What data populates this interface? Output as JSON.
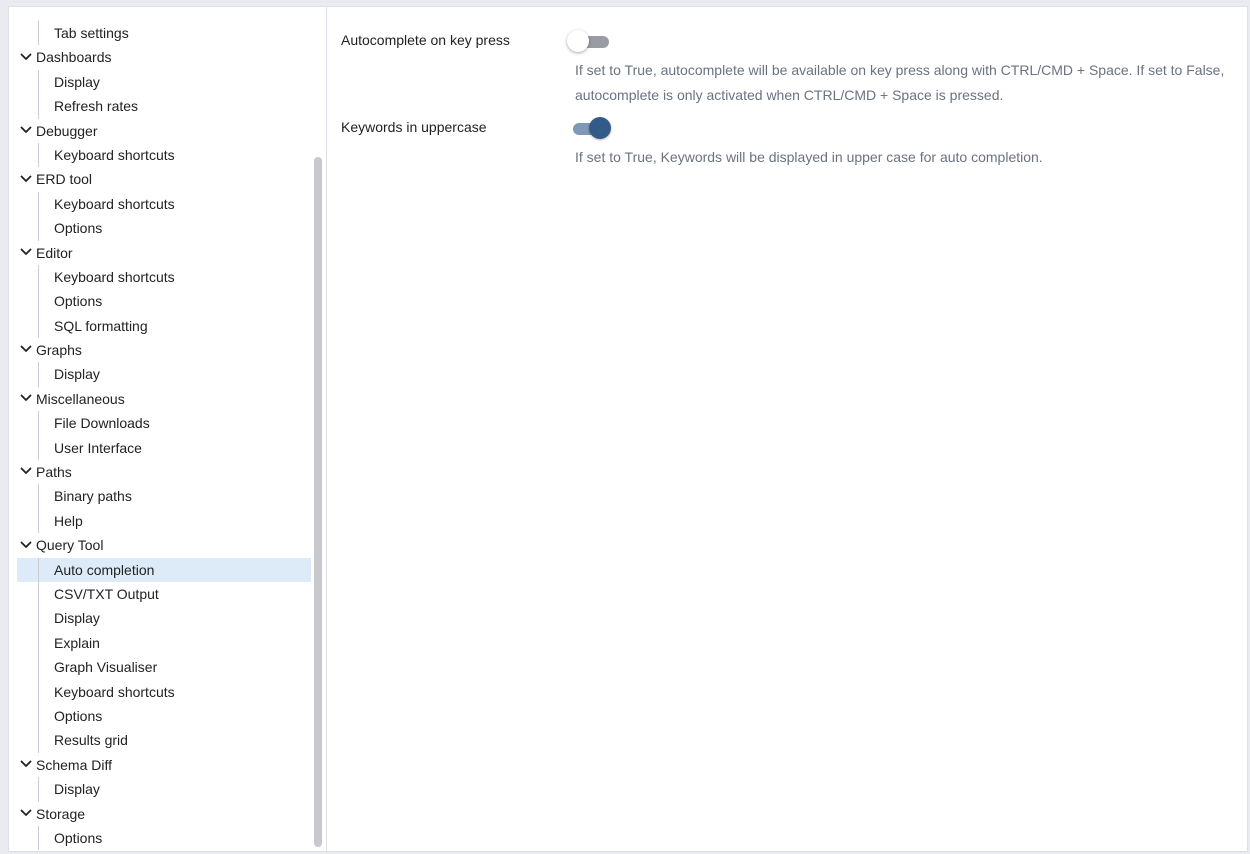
{
  "sidebar": {
    "items": [
      {
        "label": "Tab settings",
        "level": "child"
      },
      {
        "label": "Dashboards",
        "level": "group"
      },
      {
        "label": "Display",
        "level": "child"
      },
      {
        "label": "Refresh rates",
        "level": "child"
      },
      {
        "label": "Debugger",
        "level": "group"
      },
      {
        "label": "Keyboard shortcuts",
        "level": "child"
      },
      {
        "label": "ERD tool",
        "level": "group"
      },
      {
        "label": "Keyboard shortcuts",
        "level": "child"
      },
      {
        "label": "Options",
        "level": "child"
      },
      {
        "label": "Editor",
        "level": "group"
      },
      {
        "label": "Keyboard shortcuts",
        "level": "child"
      },
      {
        "label": "Options",
        "level": "child"
      },
      {
        "label": "SQL formatting",
        "level": "child"
      },
      {
        "label": "Graphs",
        "level": "group"
      },
      {
        "label": "Display",
        "level": "child"
      },
      {
        "label": "Miscellaneous",
        "level": "group"
      },
      {
        "label": "File Downloads",
        "level": "child"
      },
      {
        "label": "User Interface",
        "level": "child"
      },
      {
        "label": "Paths",
        "level": "group"
      },
      {
        "label": "Binary paths",
        "level": "child"
      },
      {
        "label": "Help",
        "level": "child"
      },
      {
        "label": "Query Tool",
        "level": "group"
      },
      {
        "label": "Auto completion",
        "level": "child",
        "selected": true
      },
      {
        "label": "CSV/TXT Output",
        "level": "child"
      },
      {
        "label": "Display",
        "level": "child"
      },
      {
        "label": "Explain",
        "level": "child"
      },
      {
        "label": "Graph Visualiser",
        "level": "child"
      },
      {
        "label": "Keyboard shortcuts",
        "level": "child"
      },
      {
        "label": "Options",
        "level": "child"
      },
      {
        "label": "Results grid",
        "level": "child"
      },
      {
        "label": "Schema Diff",
        "level": "group"
      },
      {
        "label": "Display",
        "level": "child"
      },
      {
        "label": "Storage",
        "level": "group"
      },
      {
        "label": "Options",
        "level": "child"
      }
    ],
    "expand_icon": "chevron-down-icon"
  },
  "settings": {
    "autocomplete": {
      "label": "Autocomplete on key press",
      "enabled": false,
      "help": "If set to True, autocomplete will be available on key press along with CTRL/CMD + Space. If set to False, autocomplete is only activated when CTRL/CMD + Space is pressed."
    },
    "uppercase": {
      "label": "Keywords in uppercase",
      "enabled": true,
      "help": "If set to True, Keywords will be displayed in upper case for auto completion."
    }
  },
  "colors": {
    "selected_row": "#dcebf7",
    "toggle_on_knob": "#335b8a",
    "toggle_on_track": "#7f98b5",
    "toggle_off_track": "#9a9ca3",
    "help_text": "#6b7280"
  }
}
